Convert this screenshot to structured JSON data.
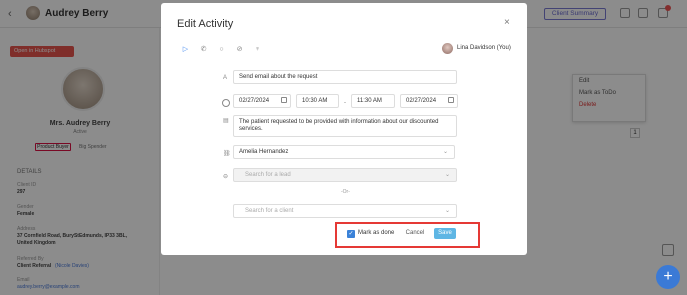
{
  "topbar": {
    "back_glyph": "‹",
    "user_name": "Audrey Berry",
    "client_summary_label": "Client Summary",
    "notification_count": "1"
  },
  "profile": {
    "hubspot_label": "Open in Hubspot",
    "name": "Mrs. Audrey Berry",
    "status": "Active",
    "tags": [
      "Product Buyer",
      "Big Spender"
    ],
    "details_header": "DETAILS",
    "fields": [
      {
        "label": "Client ID",
        "value": "297"
      },
      {
        "label": "Gender",
        "value": "Female"
      },
      {
        "label": "Address",
        "value": "37 Cornfield Road, BuryStEdmunds, IP33 3BL, United Kingdom"
      },
      {
        "label": "Referred By",
        "value": "Client Referral",
        "link": "(Nicole Davies)"
      },
      {
        "label": "Email",
        "value": "audrey.berry@example.com"
      }
    ]
  },
  "context_menu": {
    "items": [
      "Edit",
      "Mark as ToDo",
      "Delete"
    ]
  },
  "page_number": "1",
  "modal": {
    "title": "Edit Activity",
    "close_glyph": "×",
    "activity_icons": [
      "send-icon",
      "phone-icon",
      "chat-icon",
      "no-meeting-icon",
      "trophy-icon"
    ],
    "owner": "Lina Davidson (You)",
    "subject": "Send email about the request",
    "start_date": "02/27/2024",
    "start_time": "10:30 AM",
    "dash": "-",
    "end_time": "11:30 AM",
    "end_date": "02/27/2024",
    "notes": "The patient requested to be provided with information about our discounted services.",
    "assignee": "Amelia Hernandez",
    "lead_placeholder": "Search for a lead",
    "or_separator": "-Or-",
    "client_placeholder": "Search for a client",
    "mark_as_done_label": "Mark as done",
    "mark_as_done_checked": true,
    "cancel_label": "Cancel",
    "save_label": "Save"
  },
  "colors": {
    "accent": "#3b82d8",
    "save": "#5eb6e4",
    "highlight": "#e53935",
    "hubspot": "#e8554e"
  }
}
